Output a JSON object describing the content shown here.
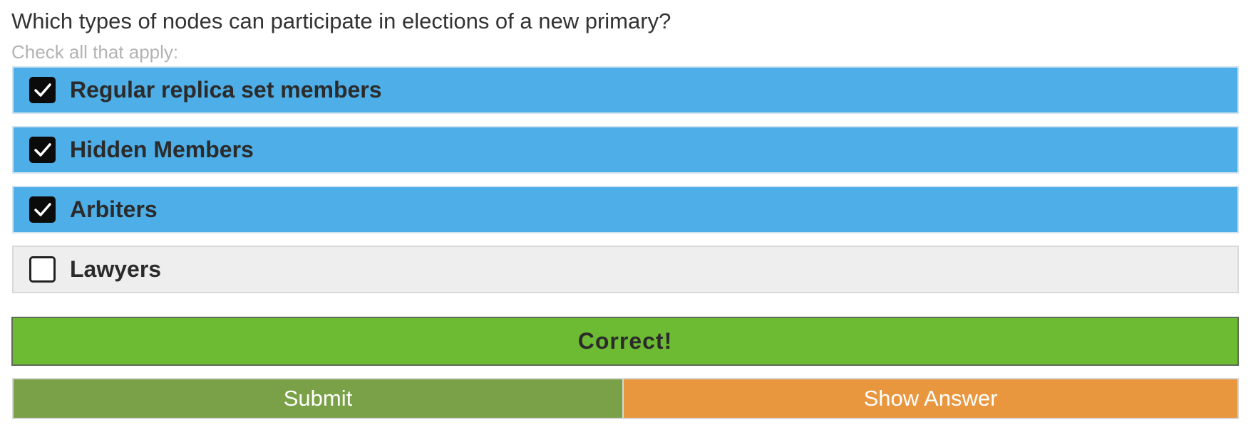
{
  "question": {
    "text": "Which types of nodes can participate in elections of a new primary?",
    "hint": "Check all that apply:"
  },
  "options": [
    {
      "label": "Regular replica set members",
      "checked": true
    },
    {
      "label": "Hidden Members",
      "checked": true
    },
    {
      "label": "Arbiters",
      "checked": true
    },
    {
      "label": "Lawyers",
      "checked": false
    }
  ],
  "result": {
    "text": "Correct!"
  },
  "buttons": {
    "submit_label": "Submit",
    "show_answer_label": "Show Answer"
  },
  "colors": {
    "checked_option_bg": "#4eaee7",
    "unchecked_option_bg": "#eeeeee",
    "result_bg": "#6dbb33",
    "submit_bg": "#7aa147",
    "show_answer_bg": "#e9973e"
  },
  "icons": {
    "checked": "checkbox-checked-icon",
    "unchecked": "checkbox-unchecked-icon"
  }
}
